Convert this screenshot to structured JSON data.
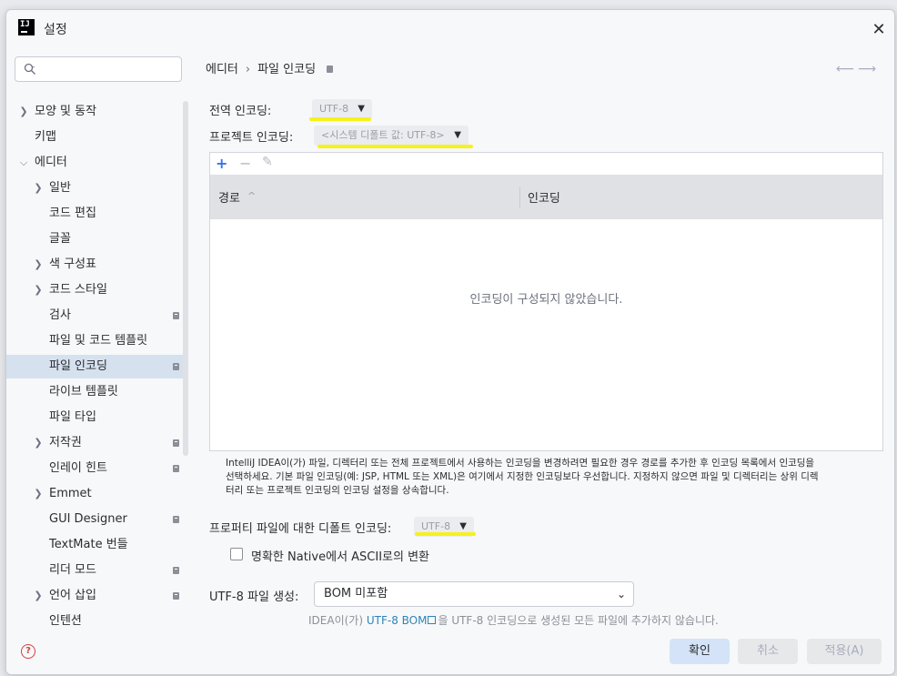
{
  "window": {
    "title": "설정"
  },
  "sidebar": {
    "search": {
      "placeholder": ""
    },
    "items": [
      {
        "label": "모양 및 동작",
        "expanded": false,
        "has_children": true
      },
      {
        "label": "키맵"
      },
      {
        "label": "에디터",
        "expanded": true,
        "has_children": true
      },
      {
        "label": "일반",
        "has_children": true
      },
      {
        "label": "코드 편집"
      },
      {
        "label": "글꼴"
      },
      {
        "label": "색 구성표",
        "has_children": true
      },
      {
        "label": "코드 스타일",
        "has_children": true
      },
      {
        "label": "검사",
        "project_icon": true
      },
      {
        "label": "파일 및 코드 템플릿"
      },
      {
        "label": "파일 인코딩",
        "selected": true,
        "project_icon": true
      },
      {
        "label": "라이브 템플릿"
      },
      {
        "label": "파일 타입"
      },
      {
        "label": "저작권",
        "has_children": true,
        "project_icon": true
      },
      {
        "label": "인레이 힌트",
        "project_icon": true
      },
      {
        "label": "Emmet",
        "has_children": true
      },
      {
        "label": "GUI Designer",
        "project_icon": true
      },
      {
        "label": "TextMate 번들"
      },
      {
        "label": "리더 모드",
        "project_icon": true
      },
      {
        "label": "언어 삽입",
        "has_children": true,
        "project_icon": true
      },
      {
        "label": "인텐션"
      }
    ]
  },
  "breadcrumb": {
    "parent": "에디터",
    "separator": "›",
    "current": "파일 인코딩"
  },
  "global_encoding": {
    "label": "전역 인코딩:",
    "value": "UTF-8"
  },
  "project_encoding": {
    "label": "프로젝트 인코딩:",
    "value": "<시스템 디폴트 값: UTF-8>"
  },
  "table": {
    "toolbar": {
      "add": "+",
      "remove": "−",
      "edit": "✎"
    },
    "columns": [
      "경로",
      "인코딩"
    ],
    "sort_indicator": "^",
    "empty_text": "인코딩이 구성되지 않았습니다."
  },
  "description_line1": "IntelliJ IDEA이(가) 파일, 디렉터리 또는 전체 프로젝트에서 사용하는 인코딩을 변경하려면 필요한 경우 경로를 추가한 후 인코딩 목록에서 인코딩을",
  "description_line2": "선택하세요. 기본 파일 인코딩(예: JSP, HTML 또는 XML)은 여기에서 지정한 인코딩보다 우선합니다. 지정하지 않으면 파일 및 디렉터리는 상위 디렉",
  "description_line3": "터리 또는 프로젝트 인코딩의 인코딩 설정을 상속합니다.",
  "properties_encoding": {
    "label": "프로퍼티 파일에 대한 디폴트 인코딩:",
    "value": "UTF-8"
  },
  "native_to_ascii": {
    "label": "명확한 Native에서 ASCII로의 변환",
    "checked": false
  },
  "utf8_bom": {
    "label": "UTF-8 파일 생성:",
    "value": "BOM 미포함",
    "note_prefix": "IDEA이(가)",
    "note_link": "UTF-8 BOM",
    "note_suffix": "을 UTF-8 인코딩으로 생성된 모든 파일에 추가하지 않습니다."
  },
  "buttons": {
    "ok": "확인",
    "cancel": "취소",
    "apply": "적용(A)"
  },
  "colors": {
    "highlight": "#f5f21c",
    "link": "#2e84b7",
    "selected_bg": "#d6e1ef",
    "primary_button": "#d4e3f7"
  }
}
